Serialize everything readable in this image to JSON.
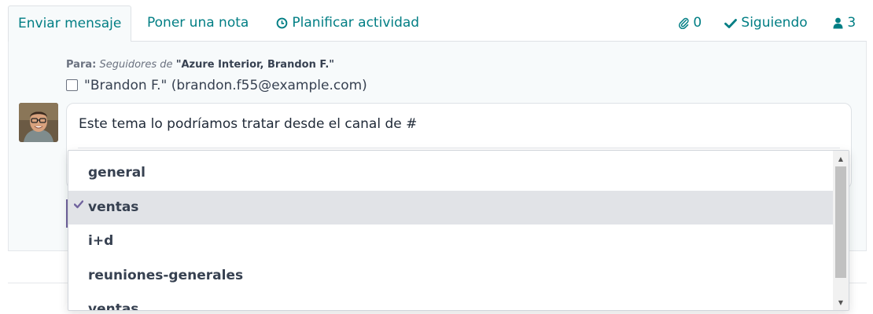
{
  "tabs": {
    "send_message": "Enviar mensaje",
    "log_note": "Poner una nota",
    "schedule_activity": "Planificar actividad",
    "attachments_count": "0",
    "following": "Siguiendo",
    "followers_count": "3"
  },
  "composer": {
    "to_label": "Para:",
    "followers_of": "Seguidores de",
    "record_name": "\"Azure Interior, Brandon F.\"",
    "recipient": "\"Brandon F.\" (brandon.f55@example.com)",
    "message_text": "Este tema lo podríamos tratar desde el canal de #"
  },
  "channel_suggestions": {
    "items": [
      "general",
      "ventas",
      "i+d",
      "reuniones-generales",
      "ventas"
    ],
    "selected_index": 1
  },
  "colors": {
    "accent": "#017e84",
    "primary": "#71639e",
    "selected_bg": "#e1e3e7"
  },
  "icons": {
    "clock": "clock-icon",
    "paperclip": "paperclip-icon",
    "check": "check-icon",
    "user": "user-icon"
  }
}
